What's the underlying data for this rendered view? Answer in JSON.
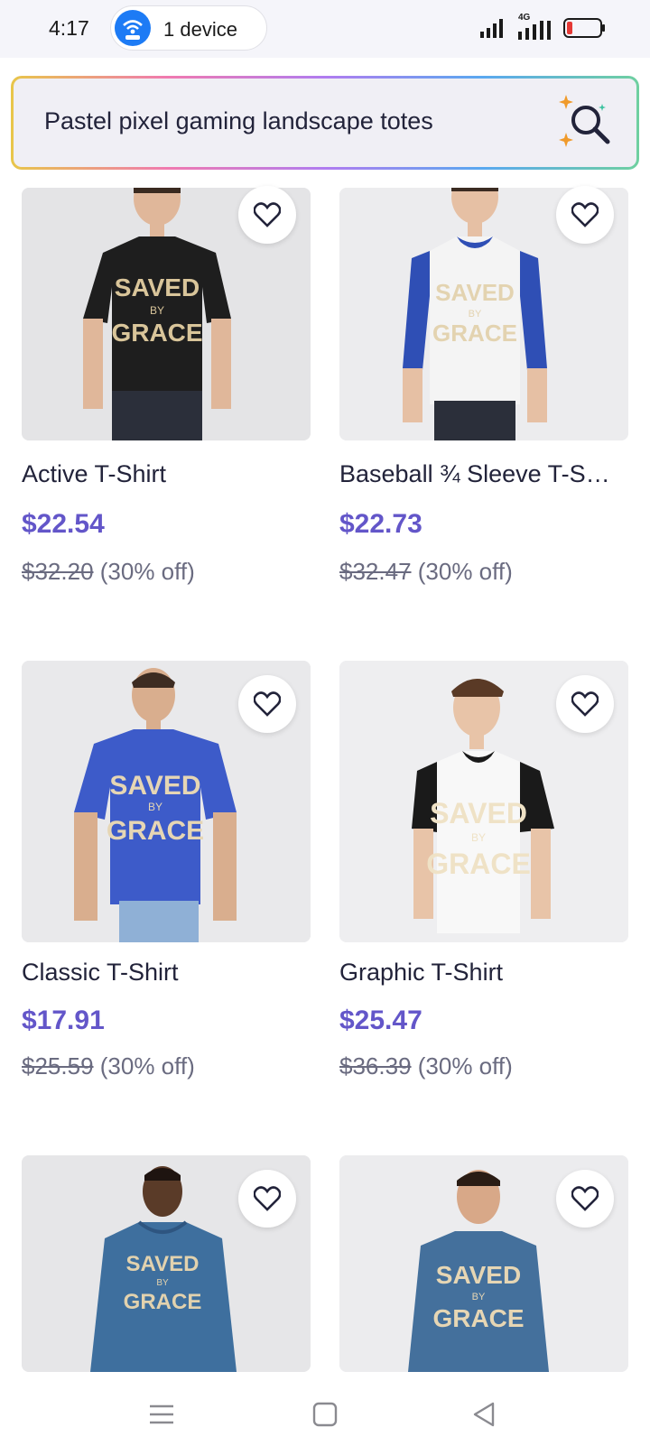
{
  "status_bar": {
    "time": "4:17",
    "device_label": "1 device",
    "network": "4G"
  },
  "search": {
    "query": "Pastel pixel gaming landscape totes"
  },
  "products": [
    {
      "title": "Active T-Shirt",
      "price": "$22.54",
      "original_price": "$32.20",
      "discount": "(30% off)",
      "shirt_color": "#1e1e1e",
      "sleeve_color": "#1e1e1e",
      "print": "SAVED BY GRACE"
    },
    {
      "title": "Baseball ¾ Sleeve T-S…",
      "price": "$22.73",
      "original_price": "$32.47",
      "discount": "(30% off)",
      "shirt_color": "#f4f4f4",
      "sleeve_color": "#2f4fb5",
      "print": "SAVED BY GRACE"
    },
    {
      "title": "Classic T-Shirt",
      "price": "$17.91",
      "original_price": "$25.59",
      "discount": "(30% off)",
      "shirt_color": "#3d5bc9",
      "sleeve_color": "#3d5bc9",
      "print": "SAVED BY GRACE"
    },
    {
      "title": "Graphic T-Shirt",
      "price": "$25.47",
      "original_price": "$36.39",
      "discount": "(30% off)",
      "shirt_color": "#f8f8f8",
      "sleeve_color": "#1a1a1a",
      "print": "SAVED BY GRACE"
    },
    {
      "title": "",
      "price": "",
      "original_price": "",
      "discount": "",
      "shirt_color": "#3e6f9e",
      "sleeve_color": "#3e6f9e",
      "print": "SAVED BY GRACE"
    },
    {
      "title": "",
      "price": "",
      "original_price": "",
      "discount": "",
      "shirt_color": "#44709c",
      "sleeve_color": "#44709c",
      "print": "SAVED BY GRACE"
    }
  ],
  "colors": {
    "accent": "#6356c9",
    "text": "#22233a",
    "muted": "#6a6b80"
  },
  "icons": {
    "favorite": "heart-outline-icon",
    "search": "sparkle-search-icon",
    "nav": [
      "menu-icon",
      "home-square-icon",
      "back-triangle-icon"
    ]
  }
}
